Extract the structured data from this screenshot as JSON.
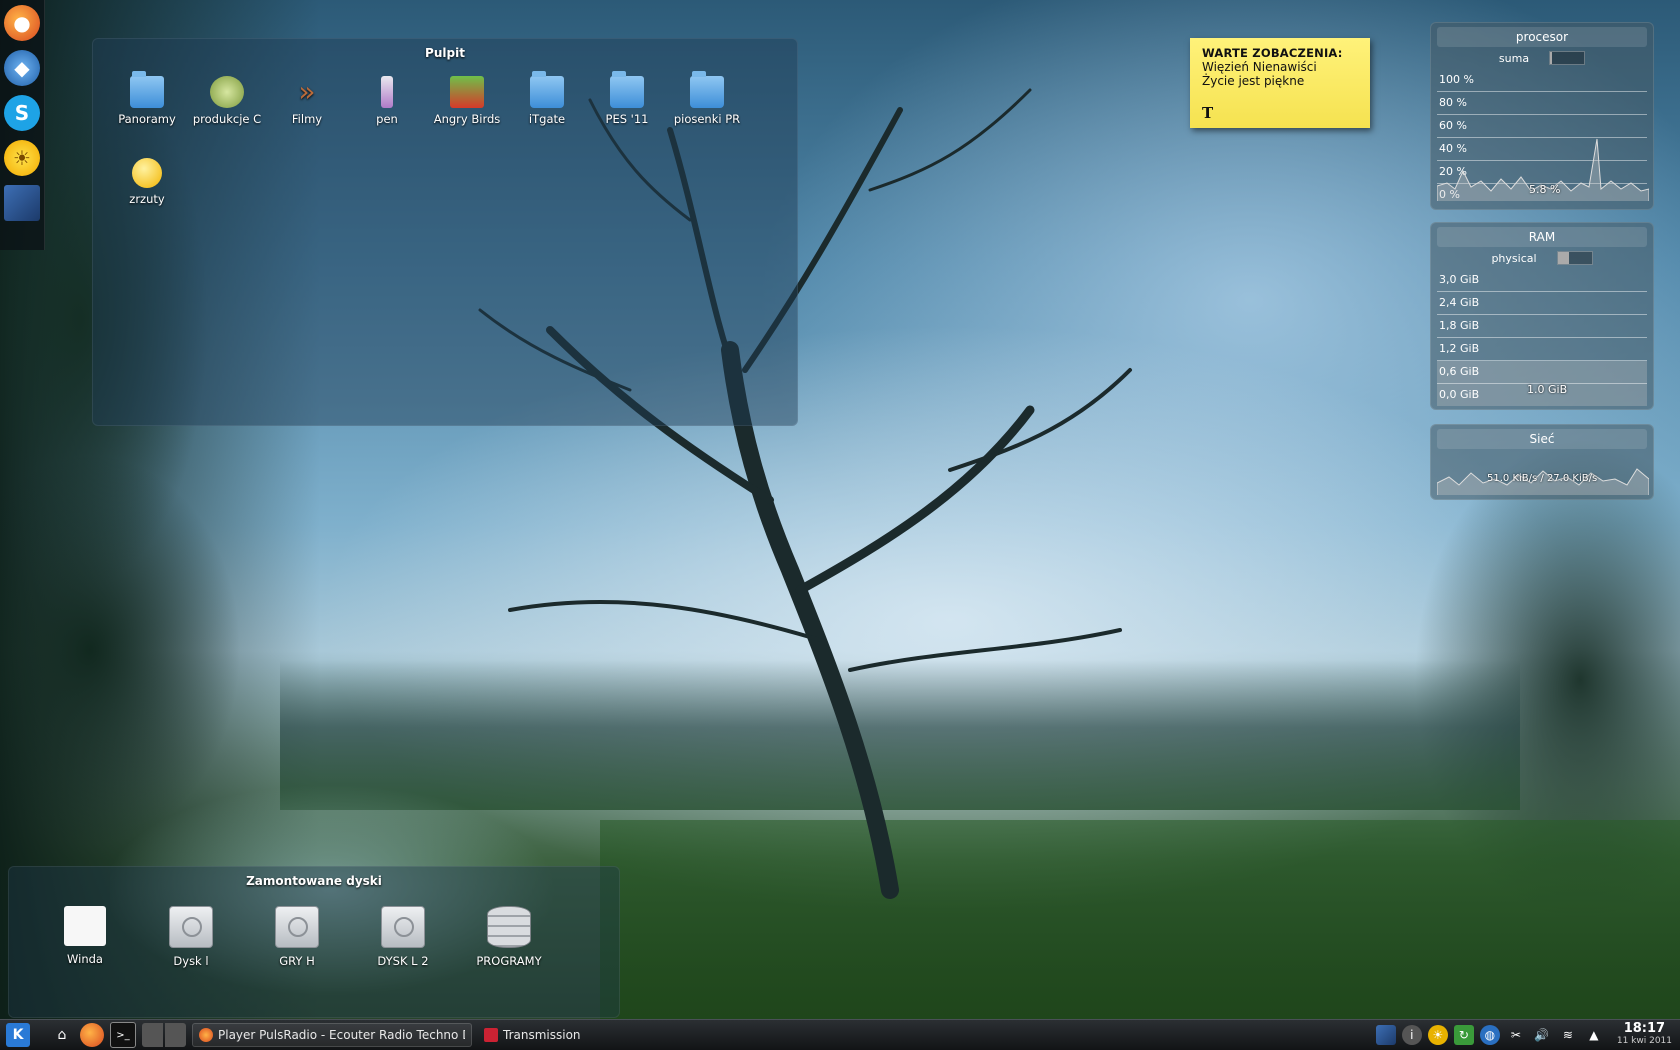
{
  "desktop_folder": {
    "title": "Pulpit",
    "items": [
      {
        "label": "Panoramy",
        "icon": "folder-pictures-icon"
      },
      {
        "label": "produkcje C",
        "icon": "cookie-monster-icon"
      },
      {
        "label": "Filmy",
        "icon": "chevrons-icon"
      },
      {
        "label": "pen",
        "icon": "usb-pen-icon"
      },
      {
        "label": "Angry Birds",
        "icon": "angry-birds-icon"
      },
      {
        "label": "iTgate",
        "icon": "folder-icon"
      },
      {
        "label": "PES '11",
        "icon": "folder-icon"
      },
      {
        "label": "piosenki PR",
        "icon": "folder-icon"
      },
      {
        "label": "zrzuty",
        "icon": "smiley-icon"
      }
    ]
  },
  "devices_panel": {
    "title": "Zamontowane dyski",
    "items": [
      {
        "label": "Winda",
        "icon": "white-disk-icon"
      },
      {
        "label": "Dysk l",
        "icon": "hard-disk-icon"
      },
      {
        "label": "GRY H",
        "icon": "hard-disk-icon"
      },
      {
        "label": "DYSK L 2",
        "icon": "hard-disk-icon"
      },
      {
        "label": "PROGRAMY",
        "icon": "database-icon"
      }
    ]
  },
  "note": {
    "heading": "WARTE ZOBACZENIA:",
    "lines": [
      "Więzień Nienawiści",
      "Życie jest piękne"
    ],
    "tool_glyph": "T"
  },
  "cpu_monitor": {
    "title": "procesor",
    "sub_label": "suma",
    "sub_fill": 0.058,
    "levels": [
      "100 %",
      "80 %",
      "60 %",
      "40 %",
      "20 %",
      "0 %"
    ],
    "value": "5.8 %"
  },
  "ram_monitor": {
    "title": "RAM",
    "sub_label": "physical",
    "sub_fill": 0.33,
    "levels": [
      "3,0 GiB",
      "2,4 GiB",
      "1,8 GiB",
      "1,2 GiB",
      "0,6 GiB",
      "0,0 GiB"
    ],
    "value": "1.0 GiB"
  },
  "net_monitor": {
    "title": "Sieć",
    "value": "51.0 KiB/s / 27.0 KiB/s"
  },
  "taskbar": {
    "tasks": [
      {
        "label": "Player PulsRadio - Ecouter Radio Techno Dance",
        "icon": "firefox-icon"
      },
      {
        "label": "Transmission",
        "icon": "transmission-icon"
      }
    ],
    "clock_time": "18:17",
    "clock_date": "11 kwi 2011"
  },
  "colors": {
    "note_yellow": "#f5e250",
    "panel_tint": "#1e3c55",
    "taskbar": "#121416"
  }
}
